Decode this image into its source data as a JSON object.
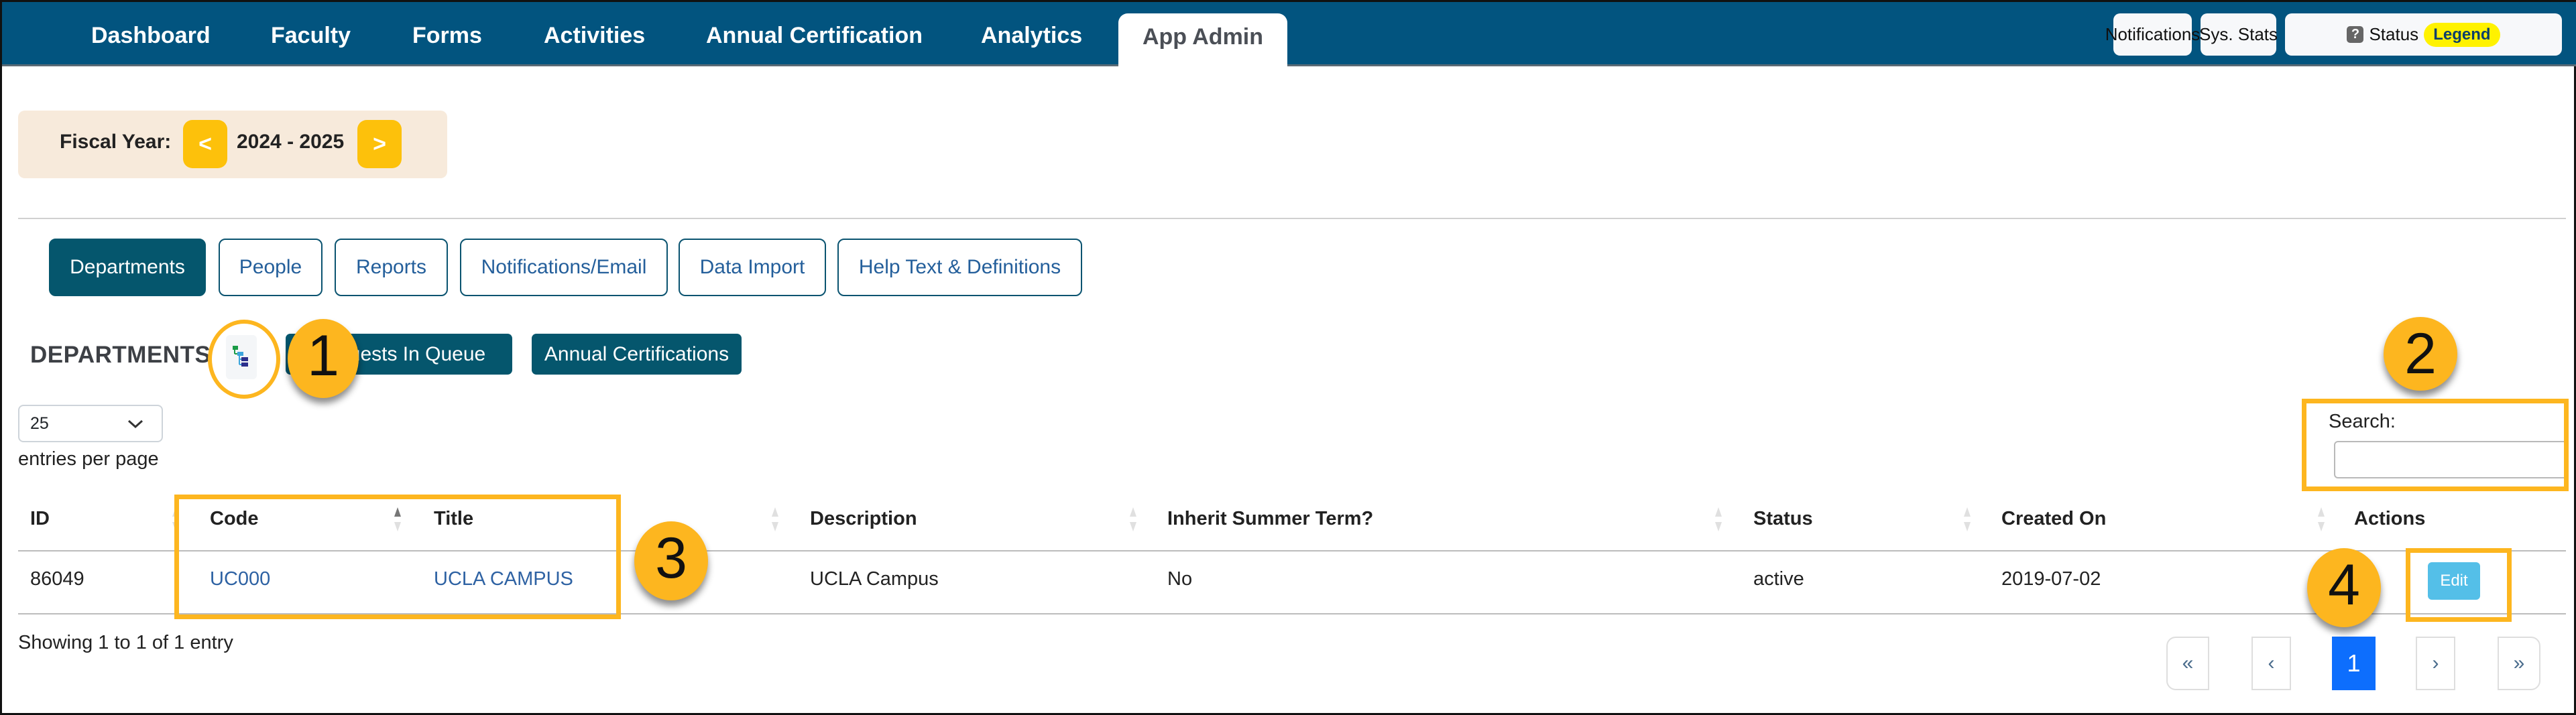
{
  "header": {
    "nav": [
      {
        "label": "Dashboard"
      },
      {
        "label": "Faculty"
      },
      {
        "label": "Forms"
      },
      {
        "label": "Activities"
      },
      {
        "label": "Annual Certification"
      },
      {
        "label": "Analytics"
      },
      {
        "label": "App Admin",
        "active": true
      }
    ],
    "buttons": {
      "notifications": "Notifications",
      "sys_stats": "Sys. Stats",
      "status": "Status",
      "legend": "Legend",
      "help_icon": "?"
    }
  },
  "fiscal_year": {
    "label": "Fiscal Year:",
    "prev": "<",
    "value": "2024 - 2025",
    "next": ">"
  },
  "tabs": [
    {
      "label": "Departments",
      "active": true
    },
    {
      "label": "People"
    },
    {
      "label": "Reports"
    },
    {
      "label": "Notifications/Email"
    },
    {
      "label": "Data Import"
    },
    {
      "label": "Help Text & Definitions"
    }
  ],
  "section": {
    "title": "DEPARTMENTS",
    "tree_icon": "hierarchy-tree-icon",
    "buttons": {
      "requests": "Requests In Queue",
      "certifications": "Annual Certifications"
    }
  },
  "table_controls": {
    "entries_value": "25",
    "entries_label": "entries per page",
    "search_label": "Search:",
    "search_value": ""
  },
  "table": {
    "columns": [
      "ID",
      "Code",
      "Title",
      "Description",
      "Inherit Summer Term?",
      "Status",
      "Created On",
      "Actions"
    ],
    "sorted_column": "Code",
    "rows": [
      {
        "id": "86049",
        "code": "UC000",
        "title": "UCLA CAMPUS",
        "description": "UCLA Campus",
        "inherit_summer": "No",
        "status": "active",
        "created_on": "2019-07-02",
        "action": "Edit"
      }
    ]
  },
  "footer": {
    "showing": "Showing 1 to 1 of 1 entry",
    "pagination": {
      "first": "«",
      "prev": "‹",
      "current": "1",
      "next": "›",
      "last": "»"
    }
  },
  "annotations": {
    "callouts": [
      "1",
      "2",
      "3",
      "4"
    ],
    "color": "#fdb61f"
  },
  "colors": {
    "header_bg": "#02547f",
    "tab_active": "#05566d",
    "accent_yellow": "#fdc10b",
    "page_current": "#0d6efd",
    "edit_button": "#54bfe8"
  }
}
